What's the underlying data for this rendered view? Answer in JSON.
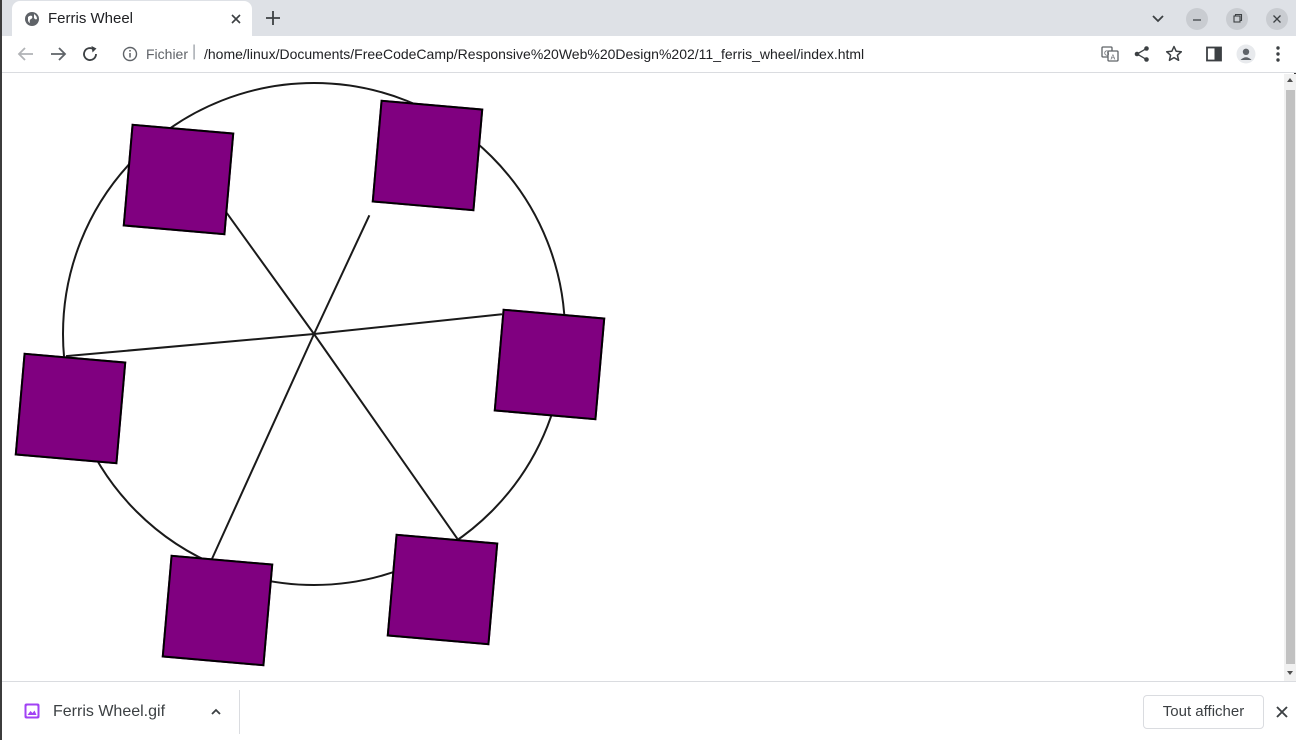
{
  "browser": {
    "tab": {
      "title": "Ferris Wheel",
      "favicon": "globe-icon",
      "close_icon": "close-icon"
    },
    "new_tab_icon": "plus-icon",
    "window_controls": [
      "chevron-down-icon",
      "minimize-icon",
      "restore-icon",
      "close-icon"
    ],
    "toolbar": {
      "back_icon": "arrow-left-icon",
      "forward_icon": "arrow-right-icon",
      "reload_icon": "reload-icon",
      "security_label": "Fichier",
      "url": "/home/linux/Documents/FreeCodeCamp/Responsive%20Web%20Design%202/11_ferris_wheel/index.html",
      "right_icons": [
        "translate-icon",
        "share-icon",
        "star-icon",
        "side-panel-icon",
        "profile-icon",
        "kebab-menu-icon"
      ]
    }
  },
  "page": {
    "wheel": {
      "border_color": "#1a1a1a",
      "spokes": 6
    },
    "cabins": {
      "count": 6,
      "color": "#800080",
      "border_color": "#000000"
    }
  },
  "download_bar": {
    "file_name": "Ferris Wheel.gif",
    "show_all_label": "Tout afficher",
    "close_icon": "close-icon"
  }
}
